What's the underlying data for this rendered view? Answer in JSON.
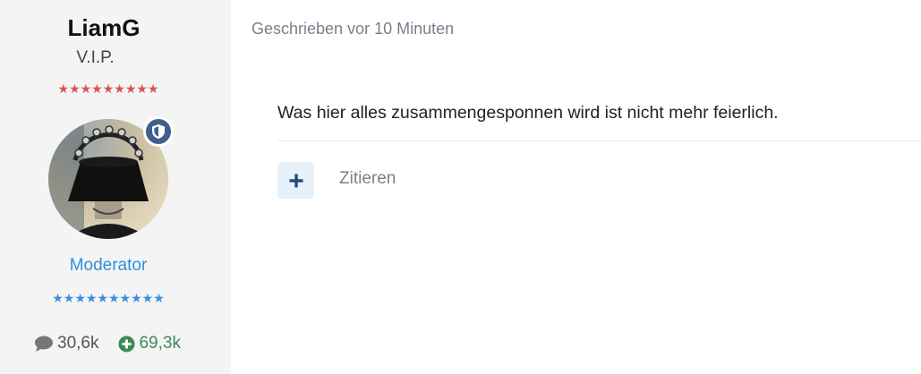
{
  "author": {
    "username": "LiamG",
    "title": "V.I.P.",
    "rank_stars_top": "★★★★★★★★★",
    "group": "Moderator",
    "rank_stars_bottom": "★★★★★★★★★★",
    "posts_count": "30,6k",
    "reactions_count": "69,3k"
  },
  "post": {
    "date": "Geschrieben vor 10 Minuten",
    "content": "Was hier alles zusammengesponnen wird ist nicht mehr feierlich.",
    "quote_label": "Zitieren"
  },
  "icons": {
    "moderator_badge": "shield-icon",
    "posts": "comment-icon",
    "reactions": "plus-circle-icon",
    "multiquote": "plus-icon"
  },
  "colors": {
    "sidebar_bg": "#f4f4f4",
    "group_link": "#2d8fdc",
    "reactions": "#3d8a59",
    "badge": "#3f5f8f",
    "multiquote_bg": "#e6f1fa",
    "multiquote_plus": "#1f4e7a"
  }
}
